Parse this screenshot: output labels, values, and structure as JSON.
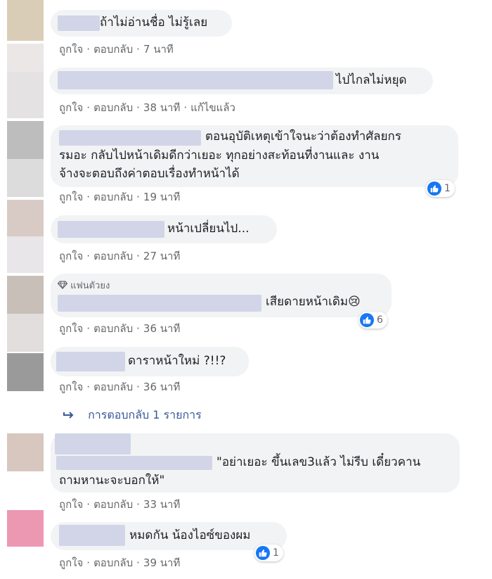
{
  "actions": {
    "like": "ถูกใจ",
    "reply": "ตอบกลับ",
    "sep": "·",
    "edited": "แก้ไขแล้ว"
  },
  "comments": [
    {
      "text_lines": [
        "ถ้าไม่อ่านชื่อ  ไม่รู้เลย"
      ],
      "time": "7 นาที",
      "avatar_color": "#d9cdb7"
    },
    {
      "text_lines": [
        "ไปไกลไม่หยุด"
      ],
      "time": "38 นาที",
      "avatar_color": "#e4e2e2"
    },
    {
      "text_lines": [
        "ตอนอุบัติเหตุเข้าใจนะว่าต้องทำศัลยกร",
        "รมอะ  กลับไปหน้าเดิมดีกว่าเยอะ  ทุกอย่างสะท้อนที่งานและ  งาน",
        "จ้างจะตอบถึงค่าตอบเรื่องทำหน้าได้"
      ],
      "time": "19 นาที",
      "reactions": "1",
      "avatar_color": "#bdbdbd"
    },
    {
      "text_lines": [
        "หน้าเปลี่ยนไป..."
      ],
      "time": "27 นาที",
      "avatar_color": "#d8cbc5"
    },
    {
      "badge": "แฟนตัวยง",
      "text_lines": [
        "เสียดายหน้าเดิม😢"
      ],
      "time": "36 นาที",
      "reactions": "6",
      "avatar_color": "#c8bfb8"
    },
    {
      "text_lines": [
        "ดาราหน้าใหม่ ?!!?"
      ],
      "time": "36 นาที",
      "avatar_color": "#9a9a9a"
    },
    {
      "text_lines": [
        "\"อย่าเยอะ  ขึ้นเลข3แล้ว  ไม่รีบ  เดี๋ยวคาน",
        "ถามหานะจะบอกให้\""
      ],
      "time": "33 นาที",
      "avatar_color": "#d7c7be"
    },
    {
      "text_lines": [
        "หมดกัน  น้องไอซ์ของผม"
      ],
      "time": "39 นาที",
      "reactions": "1",
      "avatar_color": "#ec98b3"
    }
  ],
  "reply_link": "การตอบกลับ 1 รายการ",
  "colors": {
    "link": "#385898",
    "like_blue": "#1877f2",
    "bubble_bg": "#f2f3f5",
    "meta_text": "#65676b"
  }
}
